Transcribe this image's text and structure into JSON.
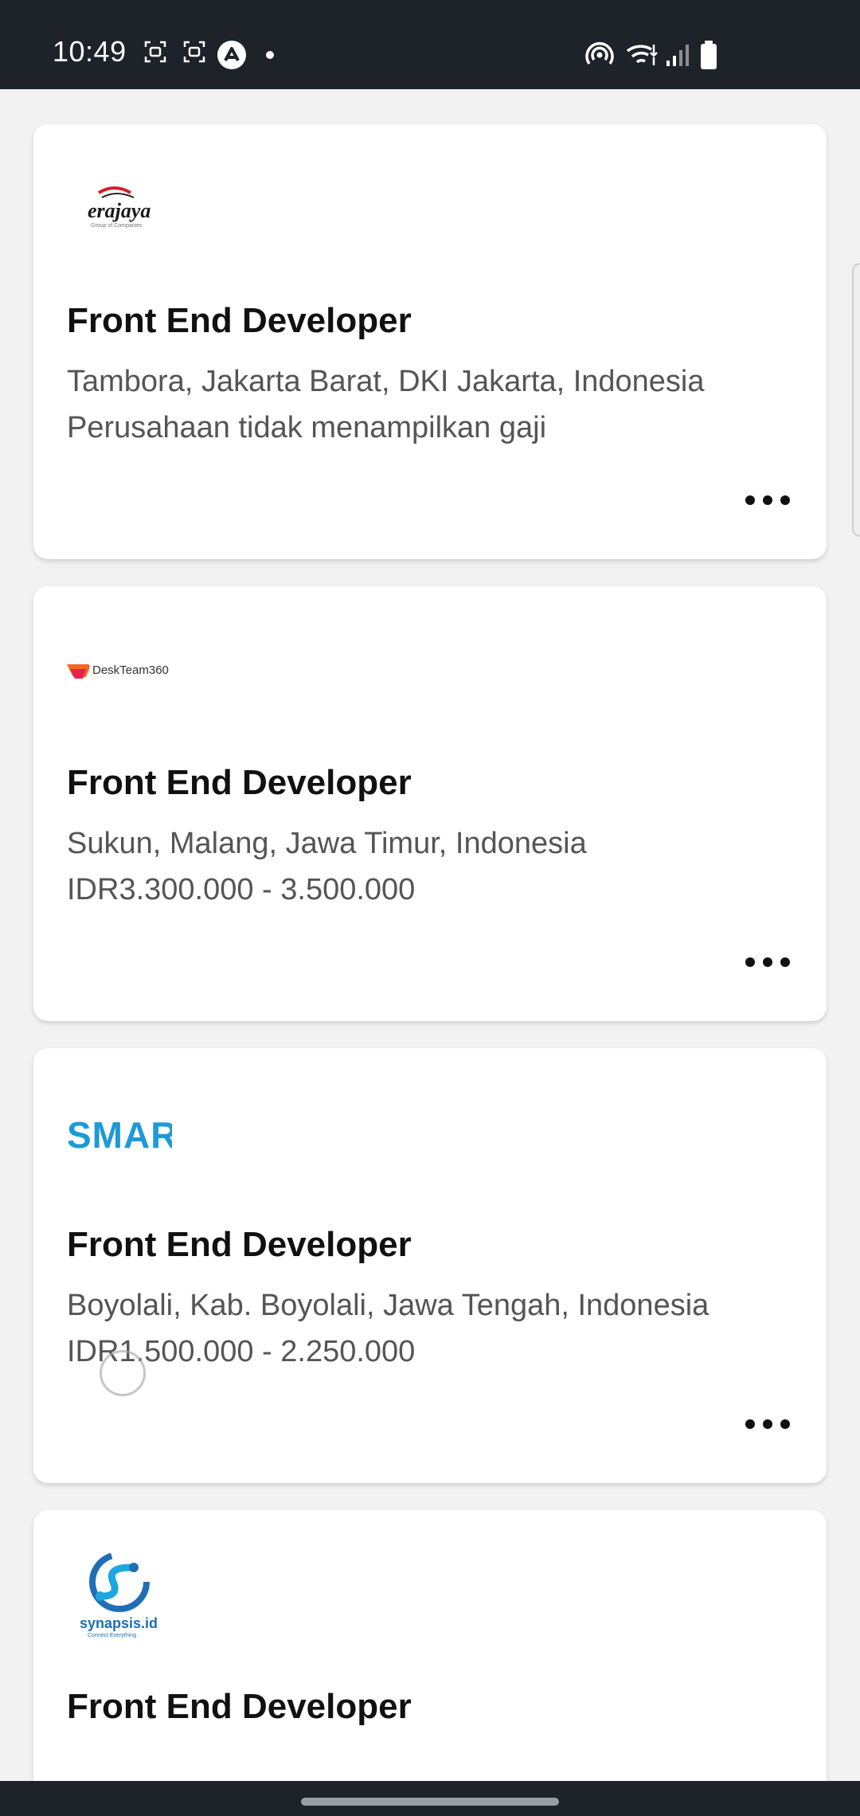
{
  "status_bar": {
    "time": "10:49",
    "icons": [
      "screenshot-icon",
      "screenshot-icon",
      "app-notification-icon",
      "dot-icon",
      "hotspot-icon",
      "wifi-icon",
      "signal-icon",
      "battery-icon"
    ]
  },
  "jobs": [
    {
      "company_logo": {
        "text": "erajaya",
        "subtext": "Group of Companies"
      },
      "title": "Front End Developer",
      "location": "Tambora, Jakarta Barat, DKI Jakarta, Indonesia",
      "salary": "Perusahaan tidak menampilkan gaji"
    },
    {
      "company_logo": {
        "text": "DeskTeam360"
      },
      "title": "Front End Developer",
      "location": "Sukun, Malang, Jawa Timur, Indonesia",
      "salary": "IDR3.300.000 - 3.500.000"
    },
    {
      "company_logo": {
        "text": "SMAR"
      },
      "title": "Front End Developer",
      "location": "Boyolali, Kab. Boyolali, Jawa Tengah, Indonesia",
      "salary": "IDR1.500.000 - 2.250.000"
    },
    {
      "company_logo": {
        "text": "synapsis.id",
        "subtext": "Connect Everything"
      },
      "title": "Front End Developer"
    }
  ],
  "colors": {
    "status_bar_bg": "#1d2329",
    "page_bg": "#f2f2f2",
    "erajaya_red": "#d32027",
    "smar_blue": "#1e9ad6",
    "synapsis_blue": "#1f6fb4"
  }
}
